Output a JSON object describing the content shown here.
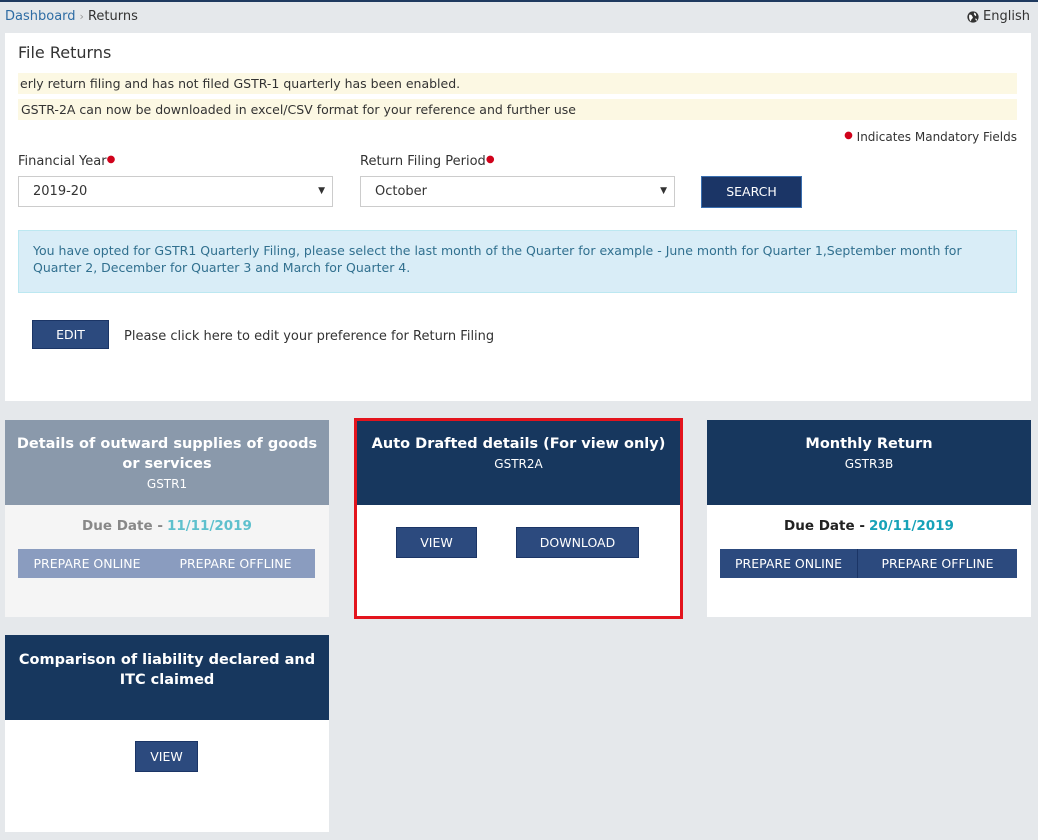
{
  "breadcrumb": {
    "home": "Dashboard",
    "separator": "›",
    "current": "Returns"
  },
  "language": {
    "label": "English",
    "icon": "globe-icon"
  },
  "panel": {
    "title": "File Returns",
    "notices": [
      "erly return filing and has not filed GSTR-1 quarterly has been enabled.",
      "GSTR-2A can now be downloaded in excel/CSV format for your reference and further use"
    ],
    "mandatory_text": "Indicates Mandatory Fields",
    "financial_year": {
      "label": "Financial Year",
      "value": "2019-20"
    },
    "return_period": {
      "label": "Return Filing Period",
      "value": "October"
    },
    "search_label": "SEARCH",
    "info_text": "You have opted for GSTR1 Quarterly Filing, please select the last month of the Quarter for example - June month for Quarter 1,September month for Quarter 2, December for Quarter 3 and March for Quarter 4.",
    "edit_label": "EDIT",
    "edit_text": "Please click here to edit your preference for Return Filing"
  },
  "tiles": {
    "gstr1": {
      "title": "Details of outward supplies of goods or services",
      "subtitle": "GSTR1",
      "due_label": "Due Date -",
      "due_date": "11/11/2019",
      "prepare_online": "PREPARE ONLINE",
      "prepare_offline": "PREPARE OFFLINE"
    },
    "gstr2a": {
      "title": "Auto Drafted details (For view only)",
      "subtitle": "GSTR2A",
      "view_label": "VIEW",
      "download_label": "DOWNLOAD"
    },
    "gstr3b": {
      "title": "Monthly Return",
      "subtitle": "GSTR3B",
      "due_label": "Due Date -",
      "due_date": "20/11/2019",
      "prepare_online": "PREPARE ONLINE",
      "prepare_offline": "PREPARE OFFLINE"
    },
    "comparison": {
      "title": "Comparison of liability declared and ITC claimed",
      "view_label": "VIEW"
    }
  },
  "colors": {
    "navy": "#17375e",
    "button": "#2c4a7e",
    "highlight_border": "#e3141d",
    "due_date": "#17a2b8"
  }
}
